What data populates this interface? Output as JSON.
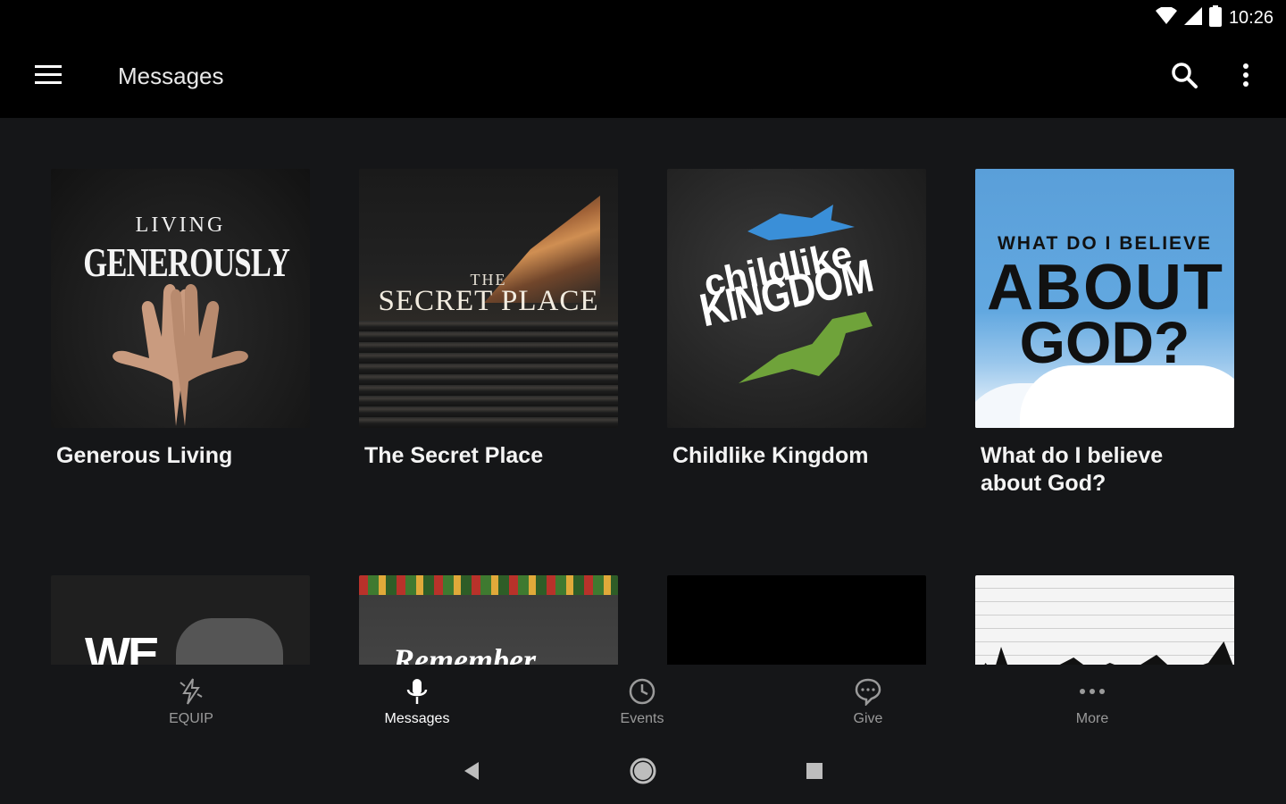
{
  "status_bar": {
    "time": "10:26",
    "icons": [
      "wifi-icon",
      "signal-icon",
      "battery-icon"
    ]
  },
  "app_bar": {
    "title": "Messages",
    "icons": {
      "menu": "hamburger-menu-icon",
      "search": "search-icon",
      "overflow": "more-vert-icon"
    }
  },
  "series": [
    {
      "title": "Generous Living",
      "art_line1": "LIVING",
      "art_line2": "GENEROUSLY"
    },
    {
      "title": "The Secret Place",
      "art_line1": "THE",
      "art_line2": "SECRET PLACE"
    },
    {
      "title": "Childlike Kingdom",
      "art_line1": "childlike",
      "art_line2": "KINGDOM"
    },
    {
      "title": "What do I believe about God?",
      "art_line1": "WHAT DO I BELIEVE",
      "art_line2": "ABOUT",
      "art_line3": "GOD?"
    },
    {
      "title": "",
      "art_line1": "WE"
    },
    {
      "title": "",
      "art_line1": "Remember"
    },
    {
      "title": ""
    },
    {
      "title": ""
    }
  ],
  "bottom_nav": [
    {
      "label": "EQUIP",
      "icon": "equip-lightning-icon",
      "active": false
    },
    {
      "label": "Messages",
      "icon": "microphone-icon",
      "active": true
    },
    {
      "label": "Events",
      "icon": "clock-icon",
      "active": false
    },
    {
      "label": "Give",
      "icon": "chat-bubble-icon",
      "active": false
    },
    {
      "label": "More",
      "icon": "more-horiz-icon",
      "active": false
    }
  ],
  "system_nav": {
    "icons": [
      "back-icon",
      "home-icon",
      "recents-icon"
    ]
  },
  "colors": {
    "background": "#151618",
    "bar": "#000000",
    "inactive_label": "#9a9a9a",
    "active_label": "#ffffff"
  }
}
